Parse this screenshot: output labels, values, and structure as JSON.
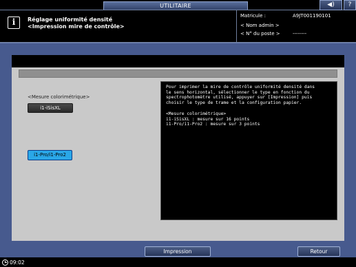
{
  "header": {
    "tab_label": "UTILITAIRE",
    "title_line1": "Réglage uniformité densité",
    "title_line2": "<Impression mire de contrôle>",
    "info_icon": "i",
    "serial_label": "Matricule :",
    "serial_value": "A9JT001190101",
    "admin_label": "< Nom admin >",
    "post_label": "< N° du poste >",
    "post_value": "--------",
    "volume_icon": "speaker-icon",
    "help_icon": "question-icon",
    "volume_glyph": "◀)",
    "help_glyph": "?"
  },
  "main": {
    "measure_label": "<Mesure colorimétrique>",
    "option_isisxl": "i1-iSisXL",
    "option_pro": "i1-Pro/i1-Pro2",
    "selected_option": "i1-Pro/i1-Pro2",
    "help_text_1": "Pour imprimer la mire de contrôle uniformité densité dans\nle sens horizontal, sélectionner le type en fonction du\nspectrophotomètre utilisé, appuyer sur [Impression] puis\nchoisir le type de trame et la configuration papier.",
    "help_text_2": "<Mesure colorimétrique>\ni1-iSisXL : mesure sur 16 points\ni1-Pro/i1-Pro2 : mesure sur 3 points"
  },
  "footer": {
    "print_label": "Impression",
    "back_label": "Retour",
    "time": "09:02"
  },
  "colors": {
    "accent": "#475a8e",
    "selected": "#2aa7e8"
  }
}
